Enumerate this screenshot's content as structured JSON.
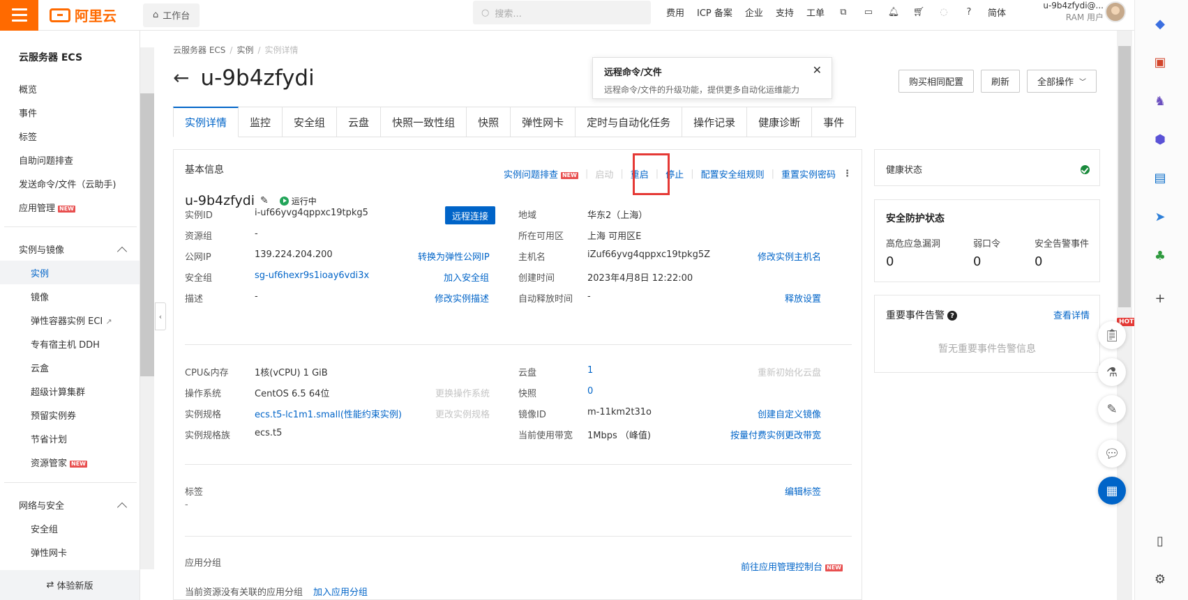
{
  "topbar": {
    "logo_text": "阿里云",
    "workbench_label": "工作台",
    "search_placeholder": "搜索...",
    "links": [
      "费用",
      "ICP 备案",
      "企业",
      "支持",
      "工单"
    ],
    "language": "简体",
    "user_name": "u-9b4zfydi@...",
    "user_role": "RAM 用户"
  },
  "sidebar": {
    "title": "云服务器 ECS",
    "items": [
      "概览",
      "事件",
      "标签",
      "自助问题排查",
      "发送命令/文件（云助手)",
      "应用管理"
    ],
    "new_badge": "NEW",
    "group1": "实例与镜像",
    "group1_items": [
      "实例",
      "镜像",
      "弹性容器实例 ECI",
      "专有宿主机 DDH",
      "云盒",
      "超级计算集群",
      "预留实例券",
      "节省计划",
      "资源管家"
    ],
    "group2": "网络与安全",
    "group2_items": [
      "安全组",
      "弹性网卡"
    ],
    "footer": "体验新版"
  },
  "breadcrumb": [
    "云服务器 ECS",
    "实例",
    "实例详情"
  ],
  "page_title": "u-9b4zfydi",
  "popover": {
    "title": "远程命令/文件",
    "desc": "远程命令/文件的升级功能，提供更多自动化运维能力"
  },
  "top_actions": [
    "购买相同配置",
    "刷新",
    "全部操作"
  ],
  "tabs": [
    "实例详情",
    "监控",
    "安全组",
    "云盘",
    "快照一致性组",
    "快照",
    "弹性网卡",
    "定时与自动化任务",
    "操作记录",
    "健康诊断",
    "事件"
  ],
  "basic": {
    "title": "基本信息",
    "actions": {
      "troubleshoot": "实例问题排查",
      "start": "启动",
      "restart": "重启",
      "stop": "停止",
      "sg_rules": "配置安全组规则",
      "reset_pwd": "重置实例密码"
    },
    "instance_name": "u-9b4zfydi",
    "status": "运行中",
    "remote_btn": "远程连接",
    "left_fields": [
      {
        "label": "实例ID",
        "value": "i-uf66yvg4qppxc19tpkg5"
      },
      {
        "label": "资源组",
        "value": "-"
      },
      {
        "label": "公网IP",
        "value": "139.224.204.200",
        "action": "转换为弹性公网IP"
      },
      {
        "label": "安全组",
        "value": "sg-uf6hexr9s1ioay6vdi3x",
        "action": "加入安全组"
      },
      {
        "label": "描述",
        "value": "-",
        "action": "修改实例描述"
      }
    ],
    "right_fields": [
      {
        "label": "地域",
        "value": "华东2（上海）"
      },
      {
        "label": "所在可用区",
        "value": "上海 可用区E"
      },
      {
        "label": "主机名",
        "value": "iZuf66yvg4qppxc19tpkg5Z",
        "action": "修改实例主机名"
      },
      {
        "label": "创建时间",
        "value": "2023年4月8日 12:22:00"
      },
      {
        "label": "自动释放时间",
        "value": "-",
        "action": "释放设置"
      }
    ],
    "spec_left": [
      {
        "label": "CPU&内存",
        "value": "1核(vCPU) 1 GiB"
      },
      {
        "label": "操作系统",
        "value": "CentOS 6.5 64位",
        "action": "更换操作系统"
      },
      {
        "label": "实例规格",
        "value": "ecs.t5-lc1m1.small(性能约束实例)",
        "action": "更改实例规格"
      },
      {
        "label": "实例规格族",
        "value": "ecs.t5"
      }
    ],
    "spec_right": [
      {
        "label": "云盘",
        "value": "1",
        "action": "重新初始化云盘"
      },
      {
        "label": "快照",
        "value": "0"
      },
      {
        "label": "镜像ID",
        "value": "m-11km2t31o",
        "action": "创建自定义镜像"
      },
      {
        "label": "当前使用带宽",
        "value": "1Mbps （峰值)",
        "action": "按量付费实例更改带宽"
      }
    ],
    "tags_label": "标签",
    "tags_value": "-",
    "tags_action": "编辑标签",
    "app_group_label": "应用分组",
    "app_group_action": "前往应用管理控制台",
    "app_group_empty": "当前资源没有关联的应用分组",
    "app_group_add": "加入应用分组"
  },
  "health": {
    "title": "健康状态"
  },
  "security": {
    "title": "安全防护状态",
    "cols": [
      {
        "label": "高危应急漏洞",
        "value": "0"
      },
      {
        "label": "弱口令",
        "value": "0"
      },
      {
        "label": "安全告警事件",
        "value": "0"
      }
    ]
  },
  "events": {
    "title": "重要事件告警",
    "link": "查看详情",
    "empty": "暂无重要事件告警信息"
  },
  "hot_badge": "HOT"
}
